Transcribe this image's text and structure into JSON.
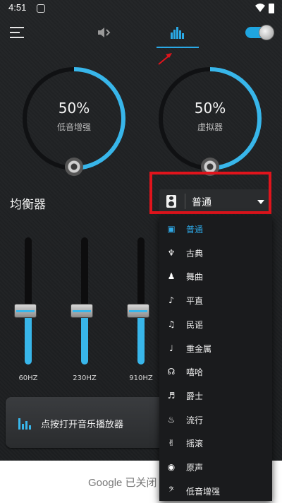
{
  "status_bar": {
    "time": "4:51"
  },
  "top_bar": {
    "tabs": [
      {
        "icon": "speaker-icon",
        "active": false
      },
      {
        "icon": "equalizer-icon",
        "active": true
      }
    ],
    "power_toggle_on": true,
    "accent": "#2aa9e6"
  },
  "knobs": [
    {
      "value": "50%",
      "label": "低音增强",
      "level": 0.5
    },
    {
      "value": "50%",
      "label": "虚拟器",
      "level": 0.5
    }
  ],
  "equalizer": {
    "title": "均衡器",
    "preset": "普通",
    "bands": [
      {
        "label": "60HZ",
        "level": 0.5
      },
      {
        "label": "230HZ",
        "level": 0.5
      },
      {
        "label": "910HZ",
        "level": 0.5
      }
    ]
  },
  "presets_menu": [
    {
      "label": "普通",
      "icon": "speaker-icon",
      "selected": true
    },
    {
      "label": "古典",
      "icon": "harp-icon",
      "selected": false
    },
    {
      "label": "舞曲",
      "icon": "dancer-icon",
      "selected": false
    },
    {
      "label": "平直",
      "icon": "trumpet-icon",
      "selected": false
    },
    {
      "label": "民谣",
      "icon": "violin-icon",
      "selected": false
    },
    {
      "label": "重金属",
      "icon": "guitar-icon",
      "selected": false
    },
    {
      "label": "嘻哈",
      "icon": "headphones-icon",
      "selected": false
    },
    {
      "label": "爵士",
      "icon": "saxophone-icon",
      "selected": false
    },
    {
      "label": "流行",
      "icon": "flame-icon",
      "selected": false
    },
    {
      "label": "摇滚",
      "icon": "rock-hand-icon",
      "selected": false
    },
    {
      "label": "原声",
      "icon": "record-icon",
      "selected": false
    },
    {
      "label": "低音增强",
      "icon": "bass-clef-icon",
      "selected": false
    }
  ],
  "player": {
    "label": "点按打开音乐播放器"
  },
  "banner": {
    "text": "Google 已关闭"
  }
}
